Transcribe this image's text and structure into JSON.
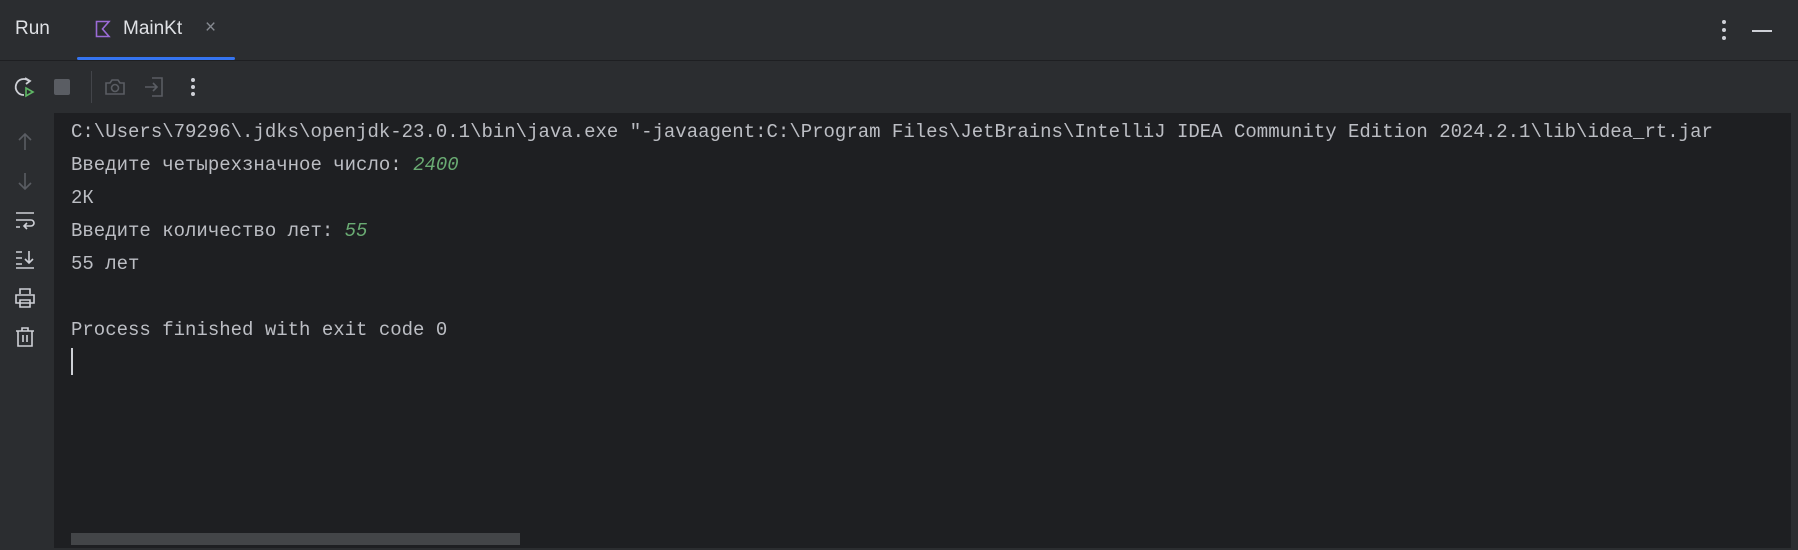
{
  "header": {
    "title": "Run",
    "tab": {
      "label": "MainKt",
      "close": "×",
      "icon": "kotlin-file-icon"
    },
    "more_icon": "more-vertical-icon",
    "minimize_icon": "minimize-icon"
  },
  "toolbar": {
    "icons": [
      "rerun-icon",
      "stop-icon",
      "screenshot-icon",
      "attach-debugger-icon",
      "more-vertical-icon"
    ]
  },
  "sidebar": {
    "icons": [
      "arrow-up-icon",
      "arrow-down-icon",
      "soft-wrap-icon",
      "scroll-to-end-icon",
      "print-icon",
      "trash-icon"
    ]
  },
  "console": {
    "lines": [
      {
        "text": "C:\\Users\\79296\\.jdks\\openjdk-23.0.1\\bin\\java.exe \"-javaagent:C:\\Program Files\\JetBrains\\IntelliJ IDEA Community Edition 2024.2.1\\lib\\idea_rt.jar",
        "input": ""
      },
      {
        "text": "Введите четырехзначное число: ",
        "input": "2400"
      },
      {
        "text": "2К",
        "input": ""
      },
      {
        "text": "Введите количество лет: ",
        "input": "55"
      },
      {
        "text": "55 лет",
        "input": ""
      },
      {
        "text": "",
        "input": ""
      },
      {
        "text": "Process finished with exit code 0",
        "input": ""
      }
    ]
  },
  "colors": {
    "accent": "#3574f0",
    "input_text": "#6aab73",
    "console_bg": "#1e1f22",
    "panel_bg": "#2b2d30",
    "text": "#bcbec4"
  }
}
